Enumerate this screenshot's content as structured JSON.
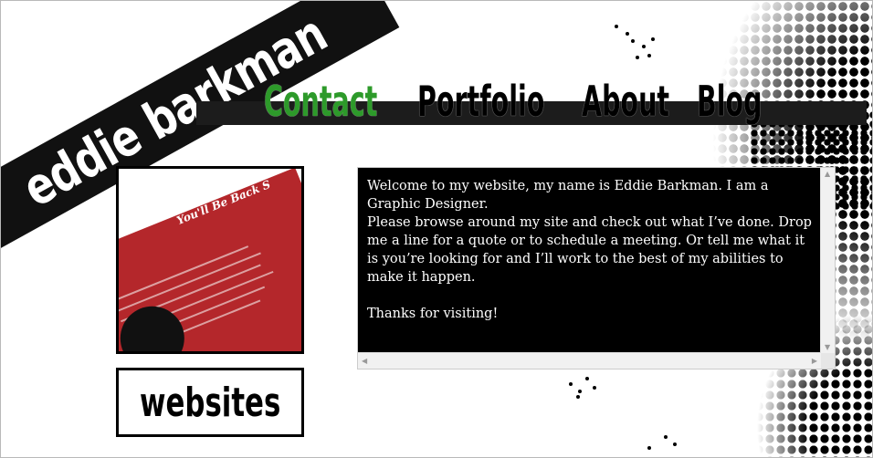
{
  "site": {
    "name": "eddie barkman"
  },
  "nav": {
    "items": [
      {
        "label": "Contact",
        "active": true
      },
      {
        "label": "Portfolio",
        "active": false
      },
      {
        "label": "About",
        "active": false
      },
      {
        "label": "Blog",
        "active": false
      }
    ],
    "active_color": "#2d9a2a"
  },
  "portfolio": {
    "thumbnail_heading": "You'll Be Back S",
    "websites_label": "websites"
  },
  "welcome": {
    "paragraphs": [
      "Welcome to my website, my name is Eddie Barkman. I am a Graphic Designer.",
      "Please browse around my site and check out what I’ve done. Drop me a line for a quote or to schedule a meeting. Or tell me what it is you’re looking for and I’ll work to the best of my abilities to make it happen.",
      "",
      "Thanks for visiting!"
    ]
  },
  "scrollbar_icons": {
    "up": "triangle-up",
    "down": "triangle-down",
    "left": "triangle-left",
    "right": "triangle-right"
  }
}
